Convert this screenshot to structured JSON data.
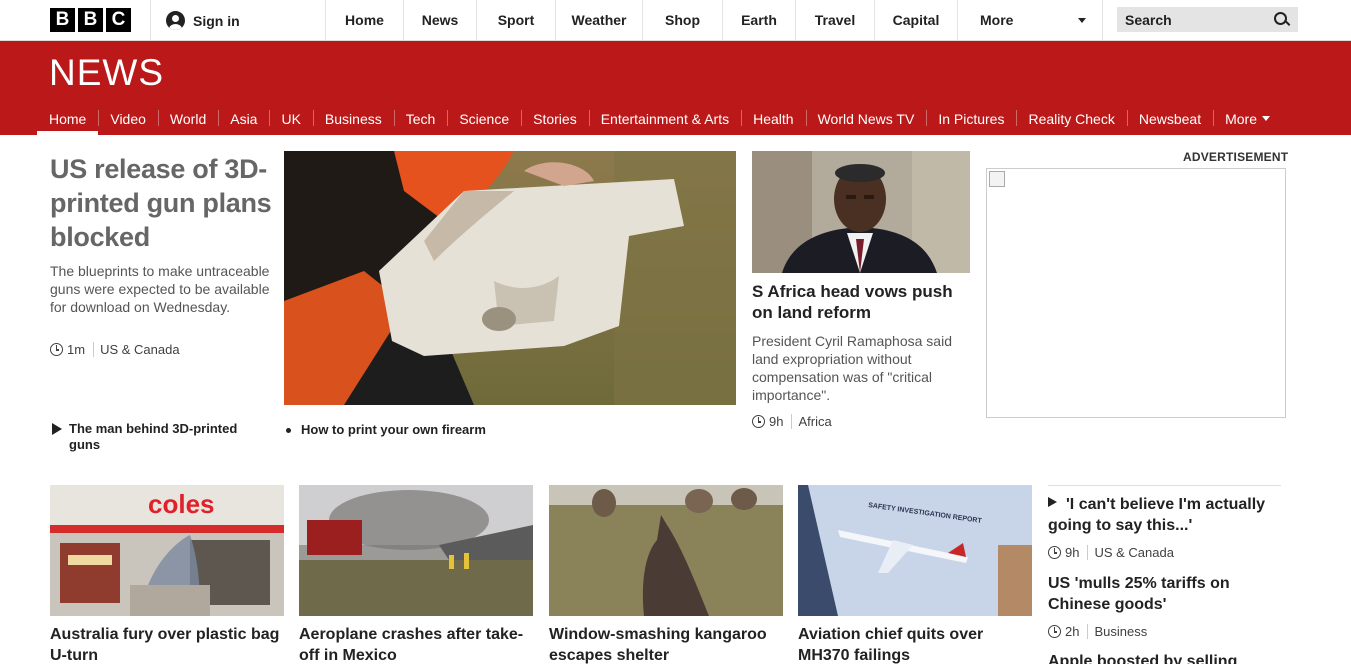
{
  "topbar": {
    "signin_label": "Sign in",
    "nav": [
      "Home",
      "News",
      "Sport",
      "Weather",
      "Shop",
      "Earth",
      "Travel",
      "Capital"
    ],
    "more_label": "More",
    "search_label": "Search"
  },
  "masthead": {
    "logo": "NEWS",
    "sections": [
      "Home",
      "Video",
      "World",
      "Asia",
      "UK",
      "Business",
      "Tech",
      "Science",
      "Stories",
      "Entertainment & Arts",
      "Health",
      "World News TV",
      "In Pictures",
      "Reality Check",
      "Newsbeat"
    ],
    "more_label": "More"
  },
  "lead": {
    "title": "US release of 3D-printed gun plans blocked",
    "summary": "The blueprints to make untraceable guns were expected to be available for download on Wednesday.",
    "time": "1m",
    "section": "US & Canada",
    "related_video": "The man behind 3D-printed guns",
    "related_link": "How to print your own firearm"
  },
  "second": {
    "title": "S Africa head vows push on land reform",
    "summary": "President Cyril Ramaphosa said land expropriation without compensation was of \"critical importance\".",
    "time": "9h",
    "section": "Africa"
  },
  "advert": {
    "label": "ADVERTISEMENT"
  },
  "row": [
    {
      "title": "Australia fury over plastic bag U-turn",
      "image_sign": "coles"
    },
    {
      "title": "Aeroplane crashes after take-off in Mexico"
    },
    {
      "title": "Window-smashing kangaroo escapes shelter"
    },
    {
      "title": "Aviation chief quits over MH370 failings",
      "image_heading": "SAFETY INVESTIGATION REPORT"
    }
  ],
  "side": [
    {
      "title": "'I can't believe I'm actually going to say this...'",
      "time": "9h",
      "section": "US & Canada"
    },
    {
      "title": "US 'mulls 25% tariffs on Chinese goods'",
      "time": "2h",
      "section": "Business"
    },
    {
      "title": "Apple boosted by selling"
    }
  ],
  "colors": {
    "brand_red": "#bb1919",
    "top_bar": "#ffffff",
    "search_bg": "#e4e4e4"
  }
}
